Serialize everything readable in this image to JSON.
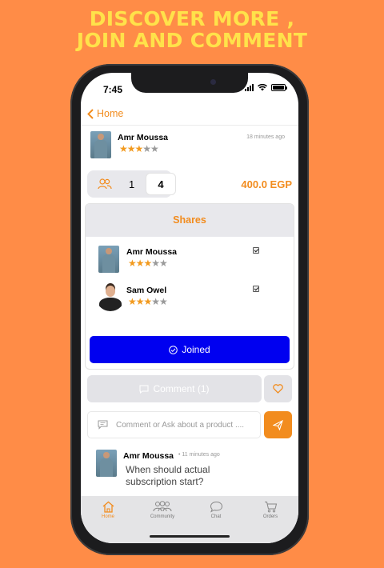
{
  "promo": {
    "line1": "DISCOVER MORE ,",
    "line2": "JOIN AND COMMENT"
  },
  "status_bar": {
    "time": "7:45"
  },
  "nav": {
    "back_label": "Home"
  },
  "post": {
    "author": "Amr Moussa",
    "time": "18 minutes ago",
    "rating": 3,
    "max_rating": 5
  },
  "quantity": {
    "selected": "1",
    "total": "4"
  },
  "price": "400.0 EGP",
  "shares": {
    "title": "Shares",
    "members": [
      {
        "name": "Amr Moussa",
        "rating": 3,
        "checked": true
      },
      {
        "name": "Sam Owel",
        "rating": 3,
        "checked": true
      }
    ],
    "joined_label": "Joined"
  },
  "actions": {
    "comment_label": "Comment (1)",
    "input_placeholder": "Comment or Ask about a product ...."
  },
  "comment": {
    "author": "Amr Moussa",
    "time": "11 minutes ago",
    "text": "When should actual subscription start?"
  },
  "tabs": [
    {
      "label": "Home",
      "icon": "home-icon",
      "active": true
    },
    {
      "label": "Community",
      "icon": "community-icon",
      "active": false
    },
    {
      "label": "Chat",
      "icon": "chat-icon",
      "active": false
    },
    {
      "label": "Orders",
      "icon": "cart-icon",
      "active": false
    }
  ],
  "colors": {
    "background": "#FF8C47",
    "headline": "#FFE24A",
    "accent": "#F28C1E",
    "joined_button": "#0000F0"
  }
}
